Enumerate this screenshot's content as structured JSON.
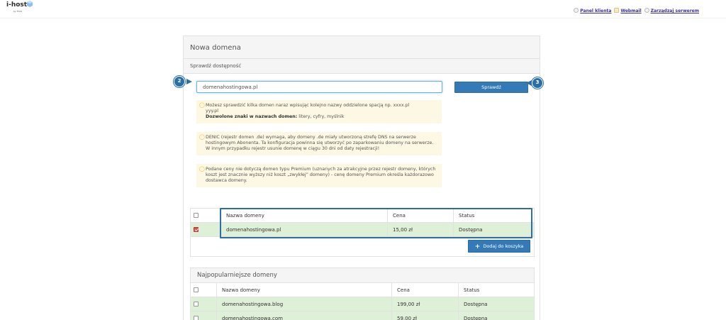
{
  "header": {
    "logo_text": "i-host",
    "logo_sub": "by Thrill",
    "links": [
      {
        "label": "Panel klienta",
        "icon": "globe-icon"
      },
      {
        "label": "Webmail",
        "icon": "mail-icon"
      },
      {
        "label": "Zarządzaj serwerem",
        "icon": "server-icon"
      }
    ]
  },
  "panel": {
    "title": "Nowa domena",
    "subtitle": "Sprawdź dostępność",
    "search_value": "domenahostingowa.pl",
    "check_label": "Sprawdź",
    "step_input": "2",
    "step_button": "3",
    "notes": [
      {
        "line1": "Możesz sprawdzić kilka domen naraz wpisując kolejno nazwy oddzielone spacją np. xxxx.pl",
        "line2": "yyy.pl",
        "bold_label": "Dozwolone znaki w nazwach domen:",
        "bold_rest": " litery, cyfry, myślnik"
      },
      {
        "text": "DENIC (rejestr domen .de) wymaga, aby domeny .de miały utworzoną strefę DNS na serwerze hostingowym Abonenta. Ta konfiguracja powinna się utworzyć po zaparkowaniu domeny na serwerze. W innym przypadku rejestr usunie domenę w ciągu 30 dni od daty rejestracji!"
      },
      {
        "text": "Podane ceny nie dotyczą domen typu Premium (uznanych za atrakcyjne przez rejestr domeny, których koszt jest znacznie wyższy niż koszt „zwykłej” domeny) - cenę domeny Premium określa każdorazowo dostawca domeny."
      }
    ]
  },
  "results": {
    "columns": [
      "Nazwa domeny",
      "Cena",
      "Status"
    ],
    "rows": [
      {
        "name": "domenahostingowa.pl",
        "price": "15,00 zł",
        "status": "Dostępna",
        "checked": true
      }
    ],
    "add_label": "Dodaj do koszyka"
  },
  "popular": {
    "title": "Najpopularniejsze domeny",
    "columns": [
      "Nazwa domeny",
      "Cena",
      "Status"
    ],
    "rows": [
      {
        "name": "domenahostingowa.blog",
        "price": "199,00 zł",
        "status": "Dostępna"
      },
      {
        "name": "domenahostingowa.com",
        "price": "59,00 zł",
        "status": "Dostępna"
      }
    ]
  },
  "colors": {
    "primary": "#337ab7",
    "success_row": "#dff0d8",
    "warning_note": "#fcf8e3",
    "annotation": "#2c6fa8"
  }
}
